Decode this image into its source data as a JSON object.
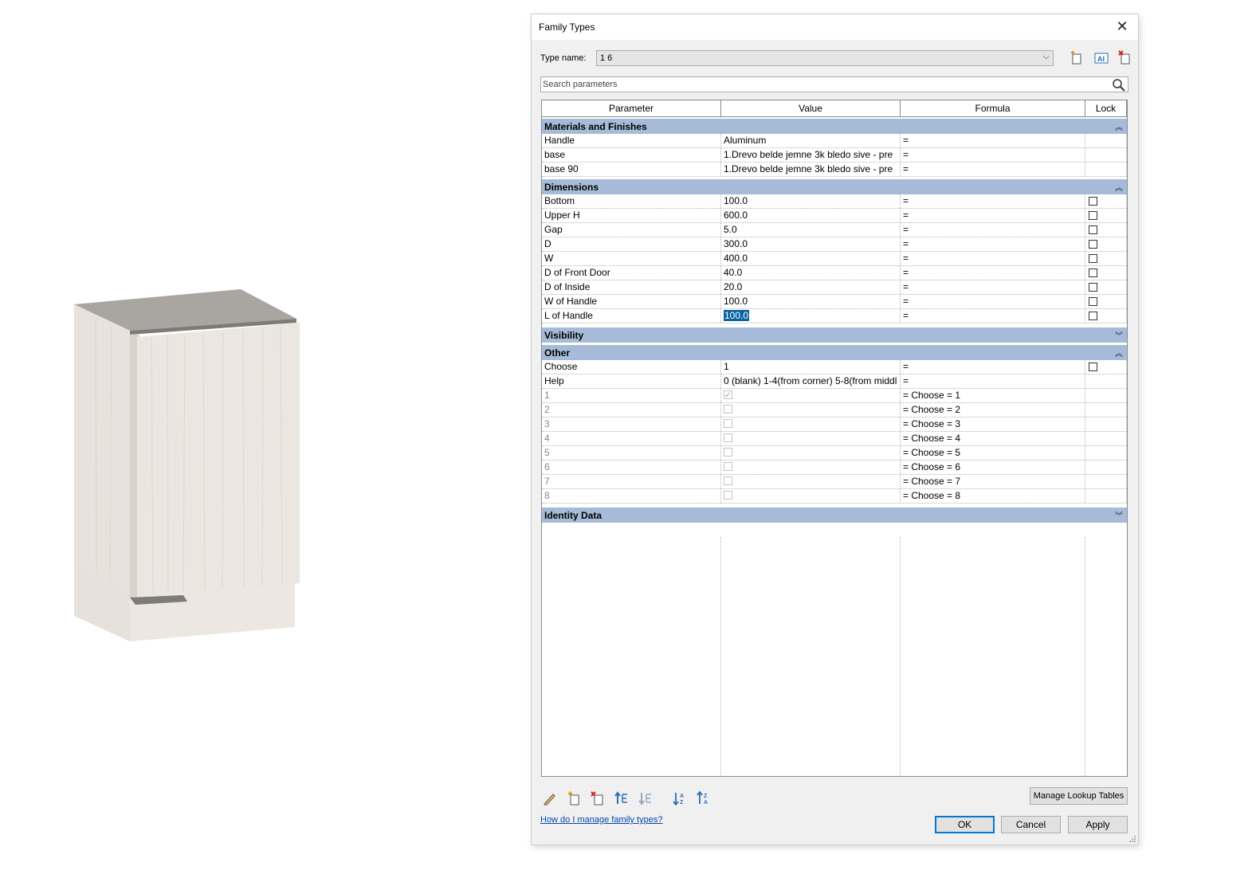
{
  "dialog": {
    "title": "Family Types",
    "type_name_label": "Type name:",
    "type_name_value": "1 6",
    "search_placeholder": "Search parameters",
    "columns": [
      "Parameter",
      "Value",
      "Formula",
      "Lock"
    ],
    "groups": {
      "materials": {
        "name": "Materials and Finishes",
        "rows": [
          {
            "param": "Handle",
            "value": "Aluminum",
            "formula": "="
          },
          {
            "param": "base",
            "value": "1.Drevo belde jemne 3k bledo sive - pre",
            "formula": "="
          },
          {
            "param": "base 90",
            "value": "1.Drevo belde jemne 3k bledo sive - pre",
            "formula": "="
          }
        ]
      },
      "dimensions": {
        "name": "Dimensions",
        "rows": [
          {
            "param": "Bottom",
            "value": "100.0",
            "formula": "="
          },
          {
            "param": "Upper H",
            "value": "600.0",
            "formula": "="
          },
          {
            "param": "Gap",
            "value": "5.0",
            "formula": "="
          },
          {
            "param": "D",
            "value": "300.0",
            "formula": "="
          },
          {
            "param": "W",
            "value": "400.0",
            "formula": "="
          },
          {
            "param": "D of Front Door",
            "value": "40.0",
            "formula": "="
          },
          {
            "param": "D of Inside",
            "value": "20.0",
            "formula": "="
          },
          {
            "param": "W of Handle",
            "value": "100.0",
            "formula": "="
          },
          {
            "param": "L of Handle",
            "value": "100.0",
            "formula": "="
          }
        ]
      },
      "visibility": {
        "name": "Visibility"
      },
      "other": {
        "name": "Other",
        "rows": [
          {
            "param": "Choose",
            "value": "1",
            "formula": "="
          },
          {
            "param": "Help",
            "value": "0 (blank) 1-4(from corner) 5-8(from middl",
            "formula": "="
          },
          {
            "param": "1",
            "formula": "= Choose = 1",
            "checked": true
          },
          {
            "param": "2",
            "formula": "= Choose = 2",
            "checked": false
          },
          {
            "param": "3",
            "formula": "= Choose = 3",
            "checked": false
          },
          {
            "param": "4",
            "formula": "= Choose = 4",
            "checked": false
          },
          {
            "param": "5",
            "formula": "= Choose = 5",
            "checked": false
          },
          {
            "param": "6",
            "formula": "= Choose = 6",
            "checked": false
          },
          {
            "param": "7",
            "formula": "= Choose = 7",
            "checked": false
          },
          {
            "param": "8",
            "formula": "= Choose = 8",
            "checked": false
          }
        ]
      },
      "identity": {
        "name": "Identity Data"
      }
    },
    "manage_lookup_label": "Manage Lookup Tables",
    "help_link": "How do I manage family types?",
    "ok_label": "OK",
    "cancel_label": "Cancel",
    "apply_label": "Apply"
  },
  "icons": [
    "new-type-icon",
    "rename-type-icon",
    "delete-type-icon",
    "search-icon",
    "edit-parameter-icon",
    "new-parameter-icon",
    "delete-parameter-icon",
    "move-up-icon",
    "move-down-icon",
    "sort-ascending-icon",
    "sort-descending-icon",
    "chevron-down-icon",
    "close-icon",
    "collapse-icon",
    "expand-icon"
  ],
  "colors": {
    "group_header": "#a5bbd7",
    "selection": "#0a64a0",
    "link": "#0645ad",
    "default_button_border": "#0078d7"
  }
}
